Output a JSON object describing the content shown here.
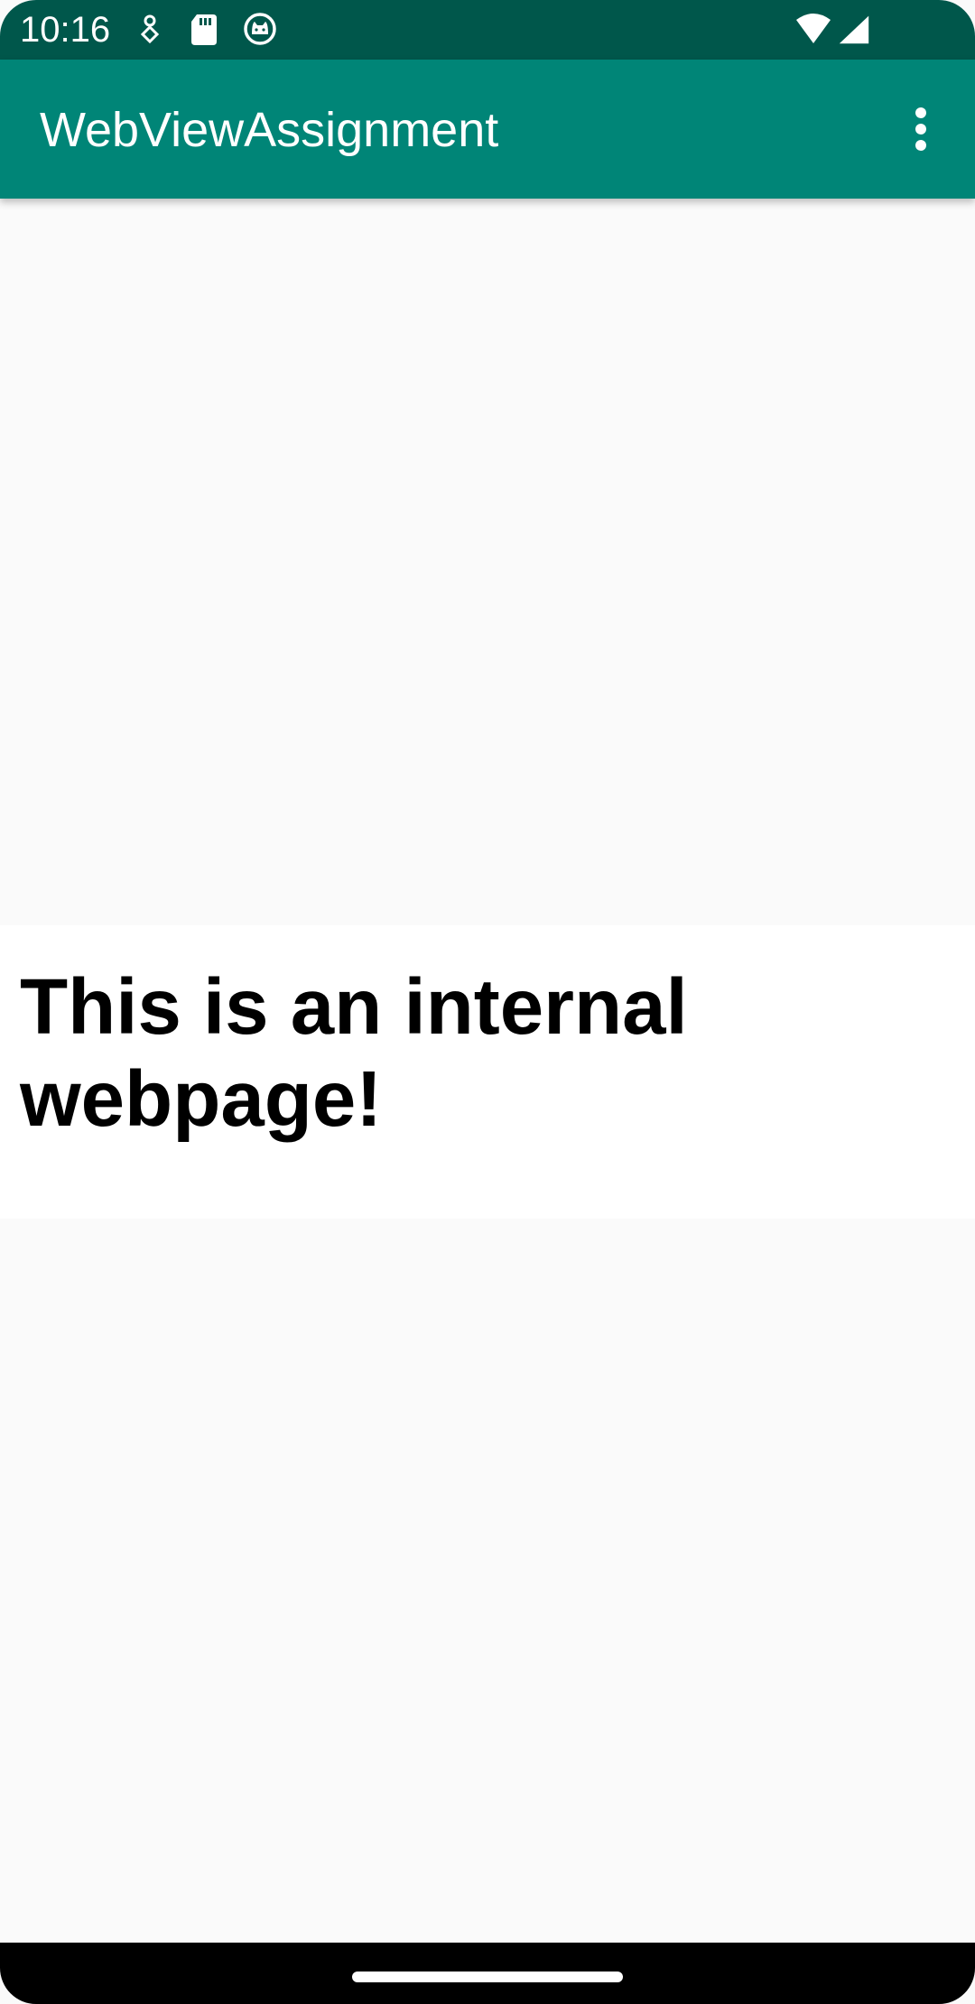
{
  "status_bar": {
    "time": "10:16",
    "icons": [
      "assistant-icon",
      "sd-card-icon",
      "cat-face-icon",
      "wifi-icon",
      "cellular-signal-icon"
    ]
  },
  "app_bar": {
    "title": "WebViewAssignment",
    "overflow_icon": "more-vert-icon"
  },
  "web_page": {
    "heading": "This is an internal webpage!"
  },
  "colors": {
    "status_bar": "#00574b",
    "app_bar": "#008577",
    "content_background": "#fafafa",
    "web_page_background": "#ffffff",
    "nav_bar": "#000000"
  }
}
